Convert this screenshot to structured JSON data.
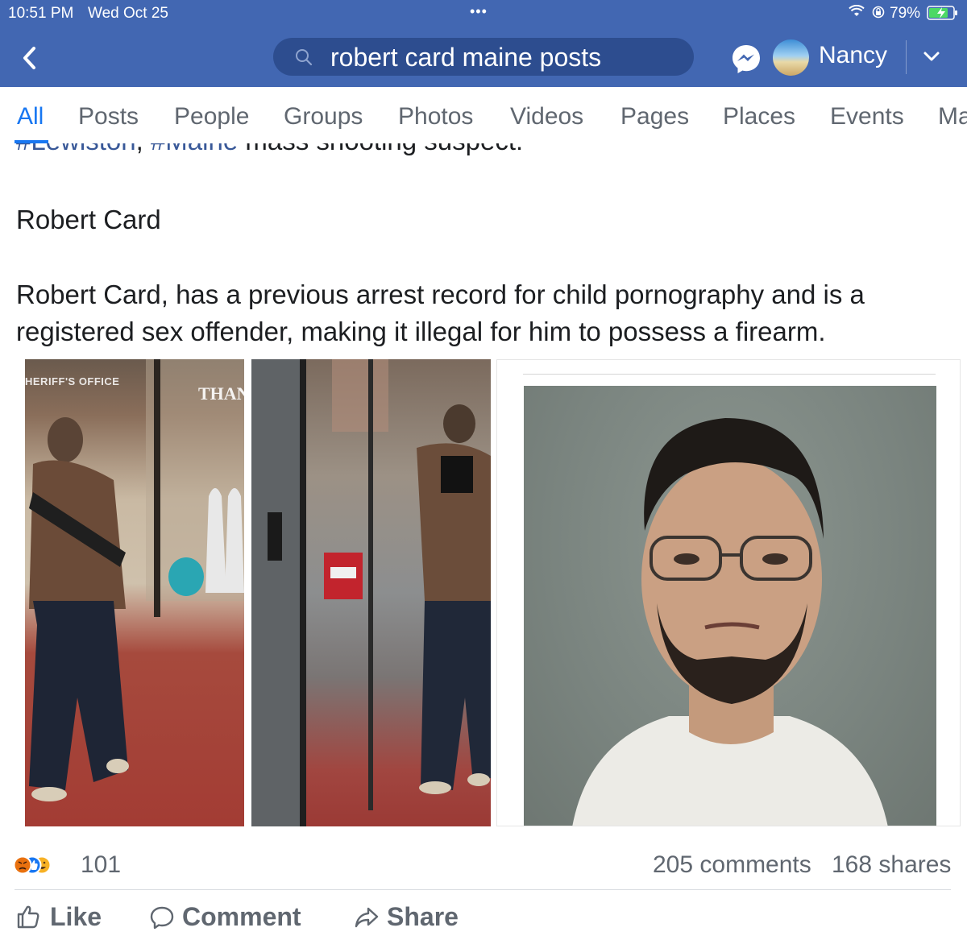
{
  "status_bar": {
    "time": "10:51 PM",
    "date": "Wed Oct 25",
    "battery": "79%"
  },
  "header": {
    "search_query": "robert card maine posts",
    "user_name": "Nancy"
  },
  "tabs": [
    {
      "label": "All",
      "active": true
    },
    {
      "label": "Posts"
    },
    {
      "label": "People"
    },
    {
      "label": "Groups"
    },
    {
      "label": "Photos"
    },
    {
      "label": "Videos"
    },
    {
      "label": "Pages"
    },
    {
      "label": "Places"
    },
    {
      "label": "Events"
    },
    {
      "label": "Ma"
    }
  ],
  "post": {
    "cut_line": {
      "tag1": "#Lewiston",
      "sep": ", ",
      "tag2": "#Maine",
      "rest": " mass shooting suspect:"
    },
    "title": "Robert Card",
    "body": "Robert Card, has a previous arrest record for child pornography and is a registered sex offender, making it illegal for him to possess a firearm.",
    "photo_caption": "HERIFF'S OFFICE",
    "photo_sign": "THAN",
    "reaction_count": "101",
    "comments": "205 comments",
    "shares": "168 shares",
    "actions": {
      "like": "Like",
      "comment": "Comment",
      "share": "Share"
    }
  },
  "colors": {
    "facebook_blue": "#4267b2",
    "active_tab": "#1877f2",
    "hashtag": "#385898"
  }
}
